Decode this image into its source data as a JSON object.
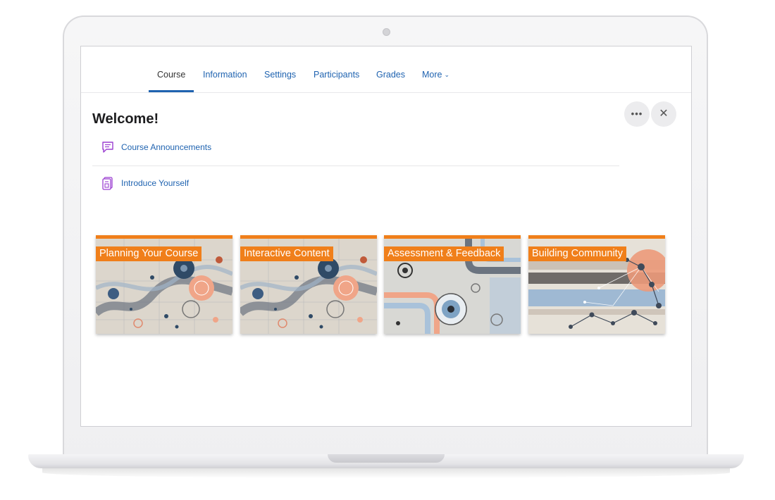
{
  "nav": {
    "tabs": [
      {
        "label": "Course"
      },
      {
        "label": "Information"
      },
      {
        "label": "Settings"
      },
      {
        "label": "Participants"
      },
      {
        "label": "Grades"
      },
      {
        "label": "More"
      }
    ],
    "active_tab": "Course"
  },
  "section": {
    "title": "Welcome!",
    "activities": [
      {
        "label": "Course Announcements",
        "icon": "forum-icon"
      },
      {
        "label": "Introduce Yourself",
        "icon": "page-icon"
      }
    ]
  },
  "actions": {
    "more_icon": "ellipsis-icon",
    "close_icon": "close-icon"
  },
  "cards": [
    {
      "title": "Planning Your Course"
    },
    {
      "title": "Interactive Content"
    },
    {
      "title": "Assessment & Feedback"
    },
    {
      "title": "Building Community"
    }
  ],
  "colors": {
    "accent": "#f07f1a",
    "link": "#1f63b0",
    "icon_purple": "#9b3fd1"
  }
}
